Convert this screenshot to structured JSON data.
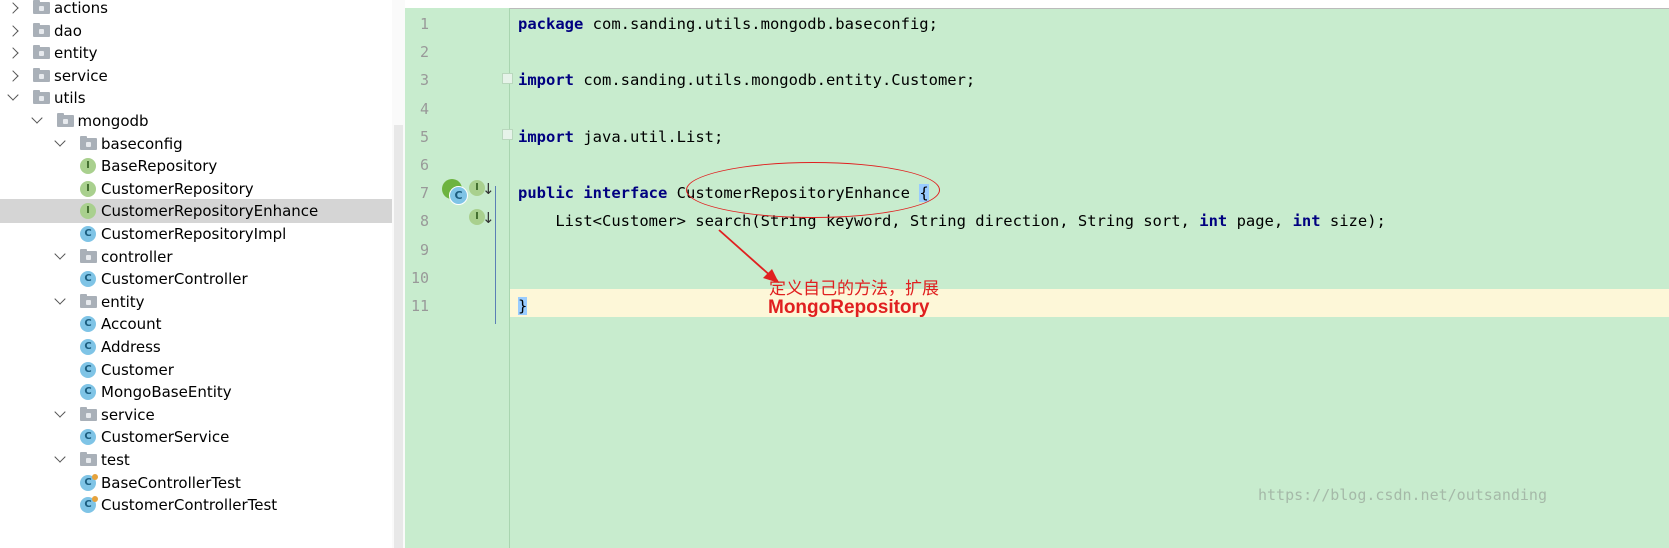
{
  "tree": {
    "items": [
      {
        "label": "actions",
        "icon": "folder-icon",
        "arrow": "right",
        "depth": 0
      },
      {
        "label": "dao",
        "icon": "folder-icon",
        "arrow": "right",
        "depth": 0
      },
      {
        "label": "entity",
        "icon": "folder-icon",
        "arrow": "right",
        "depth": 0
      },
      {
        "label": "service",
        "icon": "folder-icon",
        "arrow": "right",
        "depth": 0
      },
      {
        "label": "utils",
        "icon": "folder-icon",
        "arrow": "down",
        "depth": 0
      },
      {
        "label": "mongodb",
        "icon": "folder-icon",
        "arrow": "down",
        "depth": 1
      },
      {
        "label": "baseconfig",
        "icon": "folder-icon",
        "arrow": "down",
        "depth": 2
      },
      {
        "label": "BaseRepository",
        "icon": "interface-icon",
        "badge": "I",
        "depth": 3
      },
      {
        "label": "CustomerRepository",
        "icon": "interface-icon",
        "badge": "I",
        "depth": 3
      },
      {
        "label": "CustomerRepositoryEnhance",
        "icon": "interface-icon",
        "badge": "I",
        "depth": 3,
        "selected": true
      },
      {
        "label": "CustomerRepositoryImpl",
        "icon": "class-icon",
        "badge": "C",
        "depth": 3
      },
      {
        "label": "controller",
        "icon": "folder-icon",
        "arrow": "down",
        "depth": 2
      },
      {
        "label": "CustomerController",
        "icon": "class-icon",
        "badge": "C",
        "depth": 3
      },
      {
        "label": "entity",
        "icon": "folder-icon",
        "arrow": "down",
        "depth": 2
      },
      {
        "label": "Account",
        "icon": "class-icon",
        "badge": "C",
        "depth": 3
      },
      {
        "label": "Address",
        "icon": "class-icon",
        "badge": "C",
        "depth": 3
      },
      {
        "label": "Customer",
        "icon": "class-icon",
        "badge": "C",
        "depth": 3
      },
      {
        "label": "MongoBaseEntity",
        "icon": "class-icon",
        "badge": "C",
        "depth": 3
      },
      {
        "label": "service",
        "icon": "folder-icon",
        "arrow": "down",
        "depth": 2
      },
      {
        "label": "CustomerService",
        "icon": "class-icon",
        "badge": "C",
        "depth": 3
      },
      {
        "label": "test",
        "icon": "folder-icon",
        "arrow": "down",
        "depth": 2
      },
      {
        "label": "BaseControllerTest",
        "icon": "test-class-icon",
        "badge": "C",
        "depth": 3
      },
      {
        "label": "CustomerControllerTest",
        "icon": "test-class-icon",
        "badge": "C",
        "depth": 3
      }
    ]
  },
  "editor": {
    "lines": [
      {
        "num": "1",
        "tokens": [
          {
            "t": "package",
            "k": true
          },
          {
            "t": " com.sanding.utils.mongodb.baseconfig;"
          }
        ]
      },
      {
        "num": "2",
        "tokens": []
      },
      {
        "num": "3",
        "tokens": [
          {
            "t": "import",
            "k": true
          },
          {
            "t": " com.sanding.utils.mongodb.entity.Customer;"
          }
        ]
      },
      {
        "num": "4",
        "tokens": []
      },
      {
        "num": "5",
        "tokens": [
          {
            "t": "import",
            "k": true
          },
          {
            "t": " java.util.List;"
          }
        ]
      },
      {
        "num": "6",
        "tokens": []
      },
      {
        "num": "7",
        "tokens": [
          {
            "t": "public",
            "k": true
          },
          {
            "t": " "
          },
          {
            "t": "interface",
            "k": true
          },
          {
            "t": " CustomerRepositoryEnhance "
          },
          {
            "t": "{",
            "b": true
          }
        ]
      },
      {
        "num": "8",
        "tokens": [
          {
            "t": "    List<Customer> search(String keyword, String direction, String sort, "
          },
          {
            "t": "int",
            "k": true
          },
          {
            "t": " page, "
          },
          {
            "t": "int",
            "k": true
          },
          {
            "t": " size);"
          }
        ]
      },
      {
        "num": "9",
        "tokens": []
      },
      {
        "num": "10",
        "tokens": []
      },
      {
        "num": "11",
        "tokens": [
          {
            "t": "}",
            "b": true
          }
        ]
      }
    ],
    "gutter_icons": {
      "line7": [
        "spring-bean-icon",
        "implemented-class-icon",
        "interface-icon",
        "implemented-down-arrow-icon"
      ],
      "line8": [
        "interface-icon",
        "implemented-down-arrow-icon"
      ],
      "line7_c_badge": "C",
      "i_badge": "I"
    }
  },
  "annotation": {
    "text_cn": "定义自己的方法，扩展",
    "text_en": "MongoRepository",
    "color": "#e02020"
  },
  "watermark": "https://blog.csdn.net/outsanding",
  "colors": {
    "editor_bg": "#c8ecce",
    "keyword": "#000080",
    "current_line": "#fdf7d8",
    "selected_row": "#d5d5d5"
  }
}
